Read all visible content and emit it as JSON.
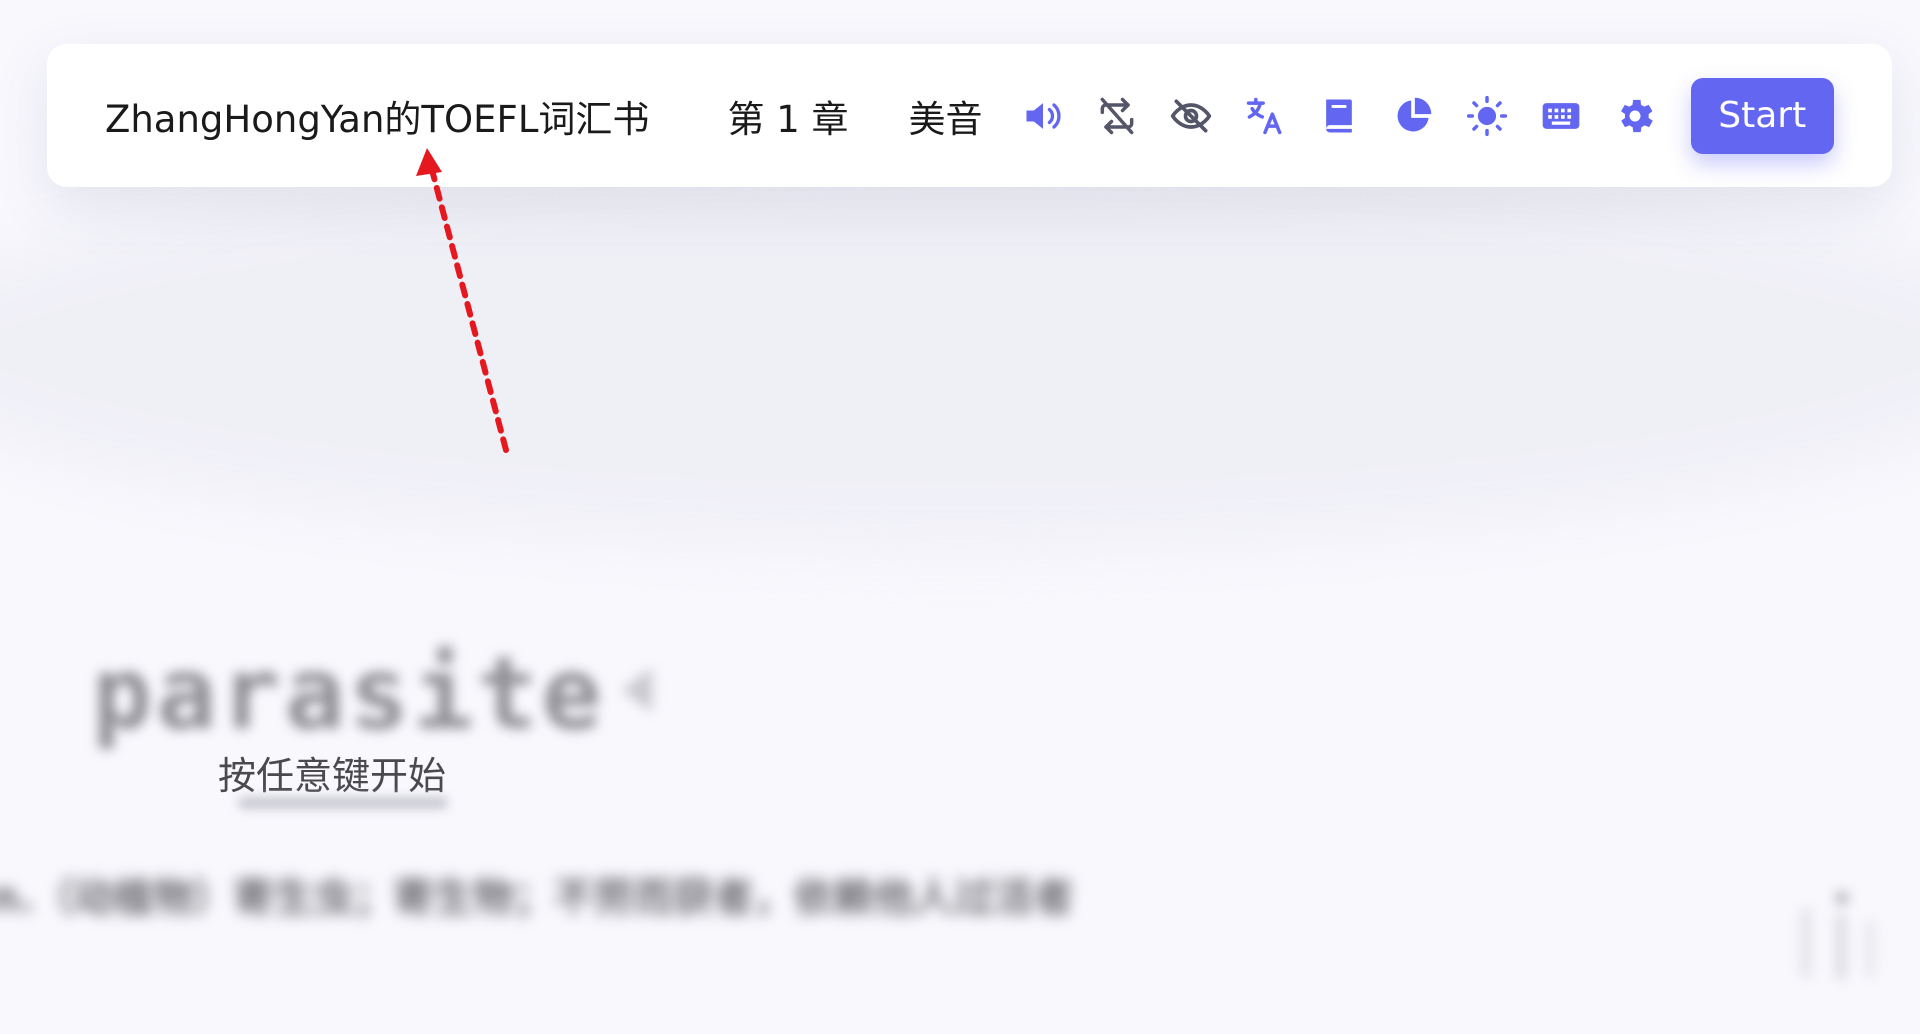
{
  "toolbar": {
    "dict_title": "ZhangHongYan的TOEFL词汇书",
    "chapter": "第 1 章",
    "accent": "美音",
    "icons": [
      "speaker-volume-icon",
      "repeat-off-icon",
      "eye-off-icon",
      "translate-icon",
      "book-icon",
      "pie-chart-icon",
      "sun-icon",
      "keyboard-icon",
      "gear-icon"
    ],
    "start_label": "Start"
  },
  "main": {
    "word": "parasite",
    "hint": "按任意键开始",
    "translation": "n.（动植物）寄生虫；寄生物；不劳而获者，依赖他人过活者"
  },
  "colors": {
    "accent": "#6366f1",
    "background": "#f8f8fd",
    "toolbar_bg": "#ffffff",
    "annotation_arrow": "#e5181f"
  }
}
